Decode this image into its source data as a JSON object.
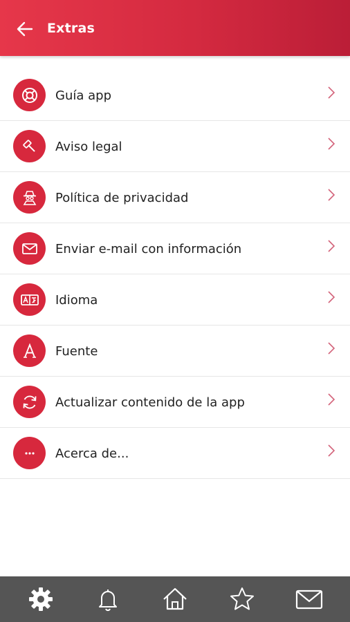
{
  "header": {
    "title": "Extras",
    "back_icon": "arrow-left-icon",
    "bg_color_start": "#e6374a",
    "bg_color_end": "#bb1e37"
  },
  "menu": {
    "items": [
      {
        "label": "Guía app",
        "icon": "lifebuoy-icon"
      },
      {
        "label": "Aviso legal",
        "icon": "gavel-icon"
      },
      {
        "label": "Política de privacidad",
        "icon": "spy-icon"
      },
      {
        "label": "Enviar e-mail con información",
        "icon": "envelope-icon"
      },
      {
        "label": "Idioma",
        "icon": "language-icon"
      },
      {
        "label": "Fuente",
        "icon": "font-icon"
      },
      {
        "label": "Actualizar contenido de la app",
        "icon": "refresh-icon"
      },
      {
        "label": "Acerca de...",
        "icon": "more-icon"
      }
    ],
    "accent_color": "#d7283d",
    "chevron_icon": "chevron-right-icon"
  },
  "bottom_nav": {
    "items": [
      {
        "icon": "gear-icon",
        "active": true
      },
      {
        "icon": "bell-icon",
        "active": false
      },
      {
        "icon": "home-icon",
        "active": false
      },
      {
        "icon": "star-icon",
        "active": false
      },
      {
        "icon": "mail-icon",
        "active": false
      }
    ],
    "bg_color": "#555555"
  }
}
